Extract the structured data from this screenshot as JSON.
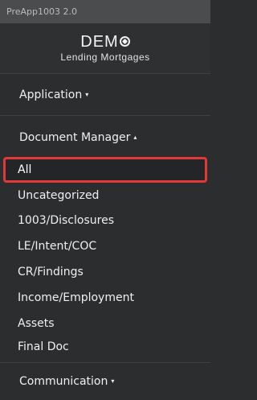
{
  "window": {
    "title": "PreApp1003 2.0"
  },
  "logo": {
    "main": "DEM",
    "sub": "Lending Mortgages"
  },
  "nav": {
    "application": {
      "label": "Application",
      "caret": "▾"
    },
    "document_manager": {
      "label": "Document Manager",
      "caret": "▴",
      "items": [
        {
          "label": "All"
        },
        {
          "label": "Uncategorized"
        },
        {
          "label": "1003/Disclosures"
        },
        {
          "label": "LE/Intent/COC"
        },
        {
          "label": "CR/Findings"
        },
        {
          "label": "Income/Employment"
        },
        {
          "label": "Assets"
        },
        {
          "label": "Final Doc"
        }
      ]
    },
    "communication": {
      "label": "Communication",
      "caret": "▾"
    }
  },
  "colors": {
    "highlight_border": "#e2383a",
    "background": "#2b2d2f"
  }
}
